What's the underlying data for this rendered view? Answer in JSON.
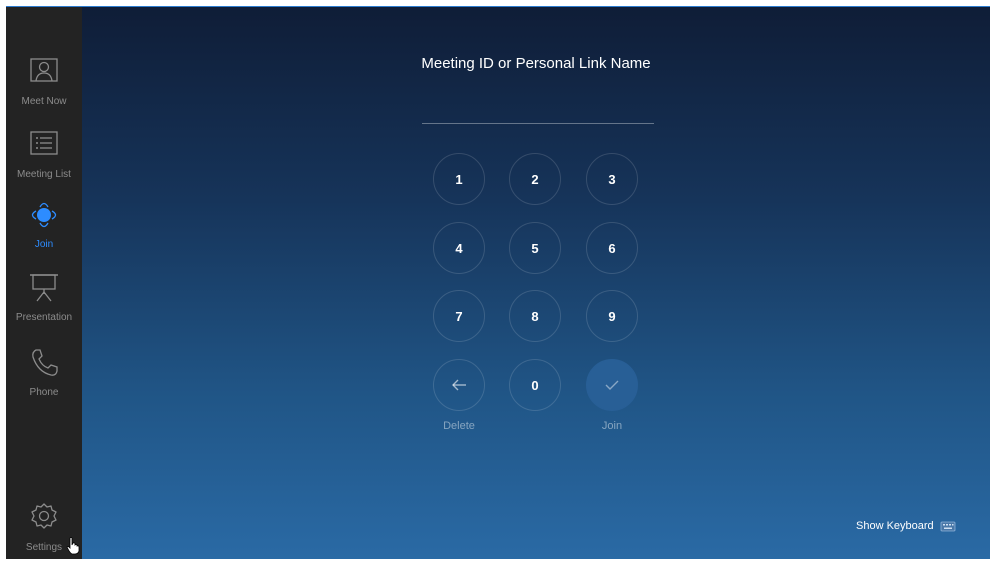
{
  "sidebar": {
    "items": [
      {
        "label": "Meet Now",
        "icon": "person-icon"
      },
      {
        "label": "Meeting List",
        "icon": "list-icon"
      },
      {
        "label": "Join",
        "icon": "join-icon",
        "active": true
      },
      {
        "label": "Presentation",
        "icon": "presentation-screen-icon"
      },
      {
        "label": "Phone",
        "icon": "phone-icon"
      }
    ],
    "settings_label": "Settings"
  },
  "join": {
    "title": "Meeting ID or Personal Link Name",
    "input_value": "",
    "keys": [
      "1",
      "2",
      "3",
      "4",
      "5",
      "6",
      "7",
      "8",
      "9",
      "0"
    ],
    "delete_label": "Delete",
    "join_label": "Join"
  },
  "footer": {
    "show_keyboard_label": "Show Keyboard"
  },
  "colors": {
    "accent": "#2d8cff",
    "sidebar_bg": "#232323",
    "join_button": "#285f96"
  }
}
